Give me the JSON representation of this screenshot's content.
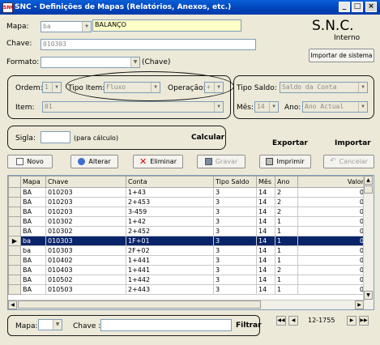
{
  "window": {
    "title": "SNC - Definições de Mapas (Relatórios, Anexos, etc.)"
  },
  "header": {
    "brand": "S.N.C.",
    "brand_sub": "Interno",
    "import_system_label": "Importar de sistema"
  },
  "form": {
    "mapa_label": "Mapa:",
    "mapa_code": "ba",
    "mapa_name": "BALANÇO",
    "chave_label": "Chave:",
    "chave_value": "010303",
    "formato_label": "Formato:",
    "formato_value": "",
    "formato_hint": "(Chave)",
    "ordem_label": "Ordem:",
    "ordem_value": "1",
    "tipo_item_label": "Tipo Item:",
    "tipo_item_value": "Fluxo",
    "operacao_label": "Operação:",
    "operacao_value": "+",
    "tipo_saldo_label": "Tipo Saldo:",
    "tipo_saldo_value": "Saldo da Conta",
    "item_label": "Item:",
    "item_value": "01",
    "mes_label": "Mês:",
    "mes_value": "14",
    "ano_label": "Ano:",
    "ano_value": "Ano Actual",
    "sigla_label": "Sigla:",
    "sigla_value": "",
    "sigla_hint": "(para cálculo)",
    "calcular_label": "Calcular",
    "exportar_label": "Exportar",
    "importar_label": "Importar"
  },
  "toolbar": {
    "novo": "Novo",
    "alterar": "Alterar",
    "eliminar": "Eliminar",
    "gravar": "Gravar",
    "imprimir": "Imprimir",
    "cancelar": "Cancelar"
  },
  "table": {
    "columns": [
      "Mapa",
      "Chave",
      "Conta",
      "Tipo Saldo",
      "Mês",
      "Ano",
      "Valor"
    ],
    "rows": [
      [
        "BA",
        "010203",
        "1+43",
        "3",
        "14",
        "2",
        "0"
      ],
      [
        "BA",
        "010203",
        "2+453",
        "3",
        "14",
        "2",
        "0"
      ],
      [
        "BA",
        "010203",
        "3-459",
        "3",
        "14",
        "2",
        "0"
      ],
      [
        "BA",
        "010302",
        "1+42",
        "3",
        "14",
        "1",
        "0"
      ],
      [
        "BA",
        "010302",
        "2+452",
        "3",
        "14",
        "1",
        "0"
      ],
      [
        "ba",
        "010303",
        "1F+01",
        "3",
        "14",
        "1",
        "0"
      ],
      [
        "ba",
        "010303",
        "2F+02",
        "3",
        "14",
        "1",
        "0"
      ],
      [
        "BA",
        "010402",
        "1+441",
        "3",
        "14",
        "1",
        "0"
      ],
      [
        "BA",
        "010403",
        "1+441",
        "3",
        "14",
        "2",
        "0"
      ],
      [
        "BA",
        "010502",
        "1+442",
        "3",
        "14",
        "1",
        "0"
      ],
      [
        "BA",
        "010503",
        "2+443",
        "3",
        "14",
        "1",
        "0"
      ]
    ],
    "selected_index": 5
  },
  "filter": {
    "mapa_label": "Mapa:",
    "chave_label": "Chave :",
    "filtrar_label": "Filtrar"
  },
  "pager": {
    "range": "12-1755"
  },
  "colors": {
    "title_bar": "#0043b8",
    "selection": "#0a246a",
    "highlight_field": "#ffffc8"
  }
}
